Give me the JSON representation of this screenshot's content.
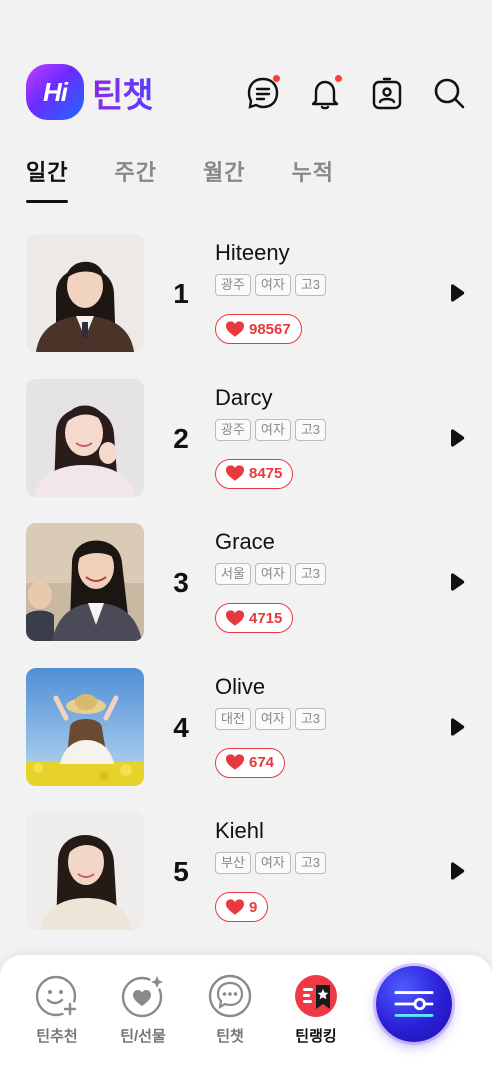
{
  "app": {
    "logo_badge": "Hi",
    "logo_text": "틴챗"
  },
  "header_icons": [
    "chat-list-icon",
    "bell-icon",
    "id-badge-icon",
    "search-icon"
  ],
  "tabs": [
    {
      "label": "일간",
      "active": true
    },
    {
      "label": "주간",
      "active": false
    },
    {
      "label": "월간",
      "active": false
    },
    {
      "label": "누적",
      "active": false
    }
  ],
  "ranking": [
    {
      "rank": "1",
      "name": "Hiteeny",
      "tags": [
        "광주",
        "여자",
        "고3"
      ],
      "likes": "98567"
    },
    {
      "rank": "2",
      "name": "Darcy",
      "tags": [
        "광주",
        "여자",
        "고3"
      ],
      "likes": "8475"
    },
    {
      "rank": "3",
      "name": "Grace",
      "tags": [
        "서울",
        "여자",
        "고3"
      ],
      "likes": "4715"
    },
    {
      "rank": "4",
      "name": "Olive",
      "tags": [
        "대전",
        "여자",
        "고3"
      ],
      "likes": "674"
    },
    {
      "rank": "5",
      "name": "Kiehl",
      "tags": [
        "부산",
        "여자",
        "고3"
      ],
      "likes": "9"
    }
  ],
  "bottom_nav": [
    {
      "label": "틴추천",
      "icon": "smile-plus-icon"
    },
    {
      "label": "틴/선물",
      "icon": "heart-gift-icon"
    },
    {
      "label": "틴챗",
      "icon": "chat-bubble-icon"
    },
    {
      "label": "틴랭킹",
      "icon": "ranking-icon",
      "active": true
    }
  ],
  "colors": {
    "accent_purple": "#7a2cf0",
    "like_red": "#e8393f",
    "fab_blue": "#2a1fd6"
  }
}
